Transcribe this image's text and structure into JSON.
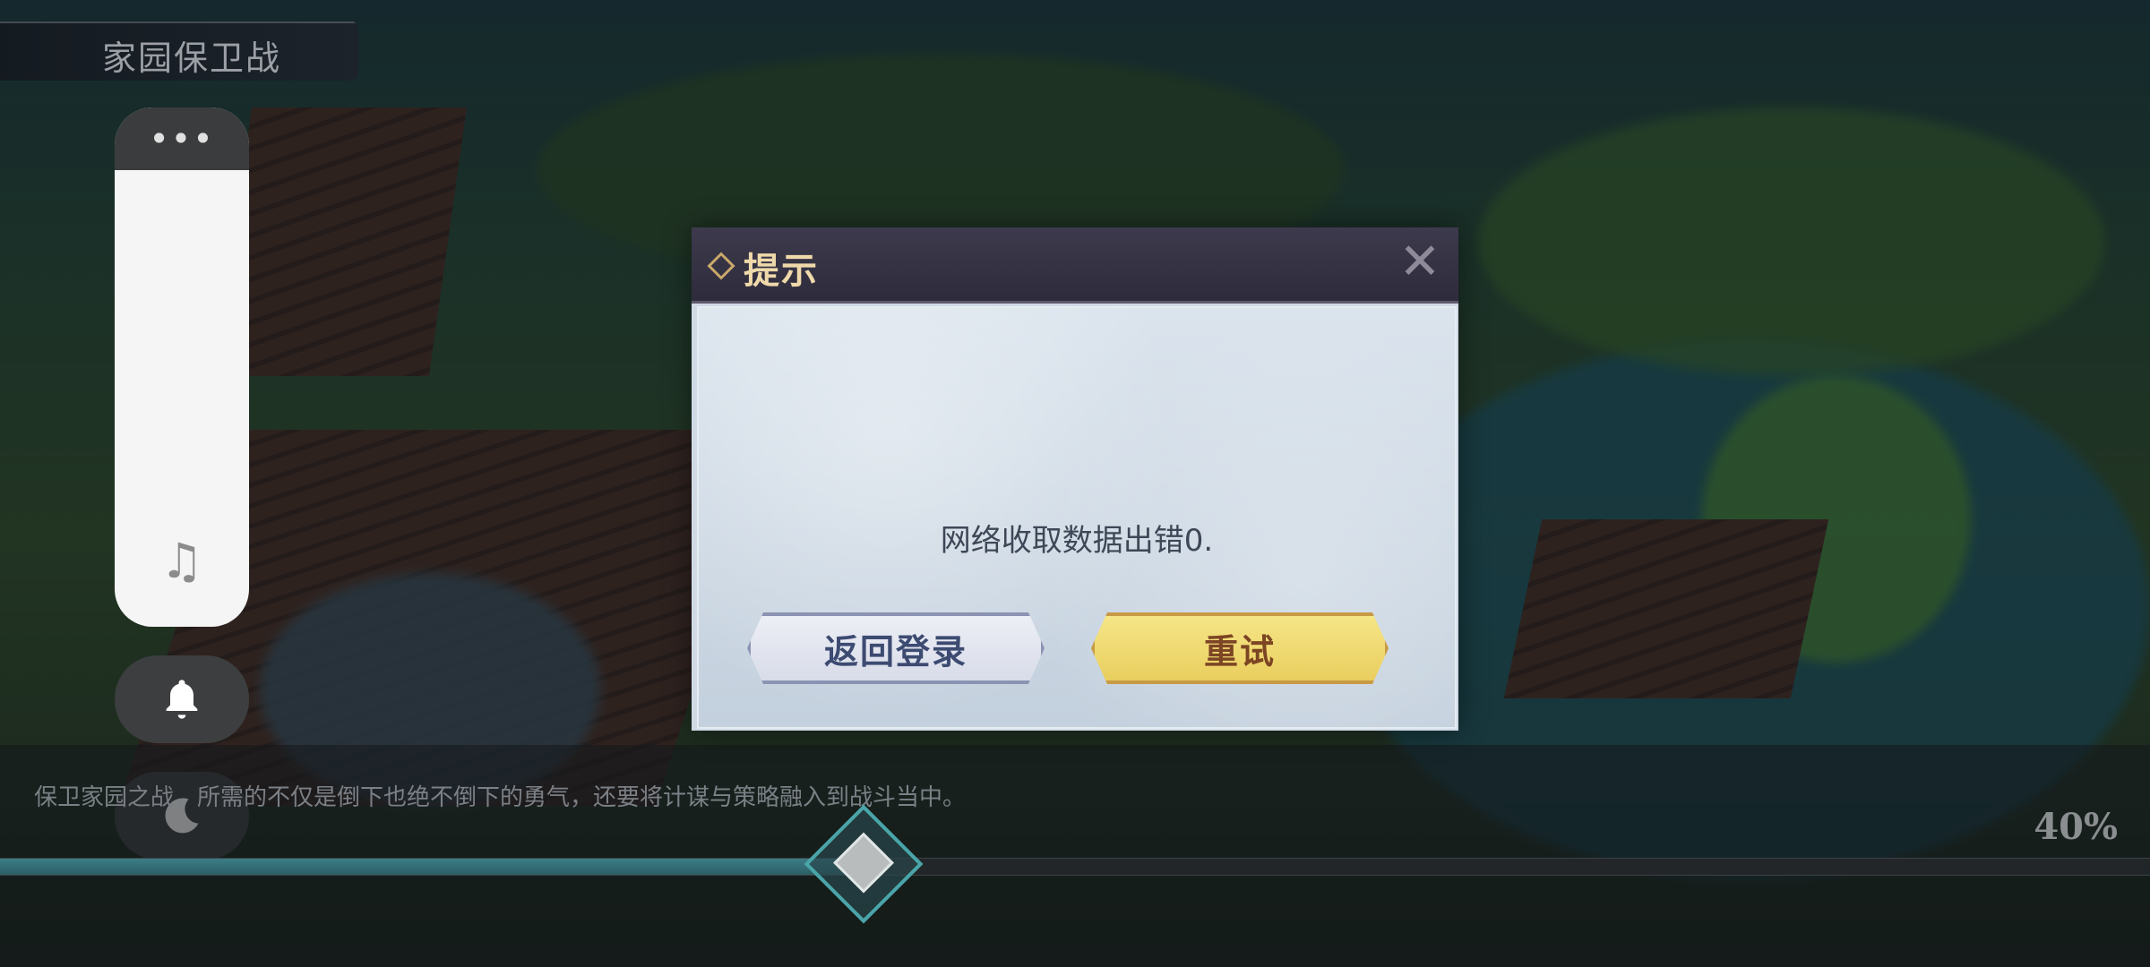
{
  "game": {
    "title": "家园保卫战"
  },
  "toolbar": {
    "menu_label": "•••",
    "music_icon": "♫",
    "bell_icon": "bell-icon",
    "moon_icon": "moon-icon"
  },
  "loading": {
    "tip": "保卫家园之战，所需的不仅是倒下也绝不倒下的勇气，还要将计谋与策略融入到战斗当中。",
    "percent_label": "40%",
    "progress": 0.4
  },
  "dialog": {
    "title": "提示",
    "message": "网络收取数据出错0.",
    "back_label": "返回登录",
    "retry_label": "重试"
  },
  "colors": {
    "progress_fill": "#3c7d86",
    "retry_button": "#f3e07c",
    "back_button": "#e6e9f2",
    "dialog_title": "#efd9aa"
  }
}
